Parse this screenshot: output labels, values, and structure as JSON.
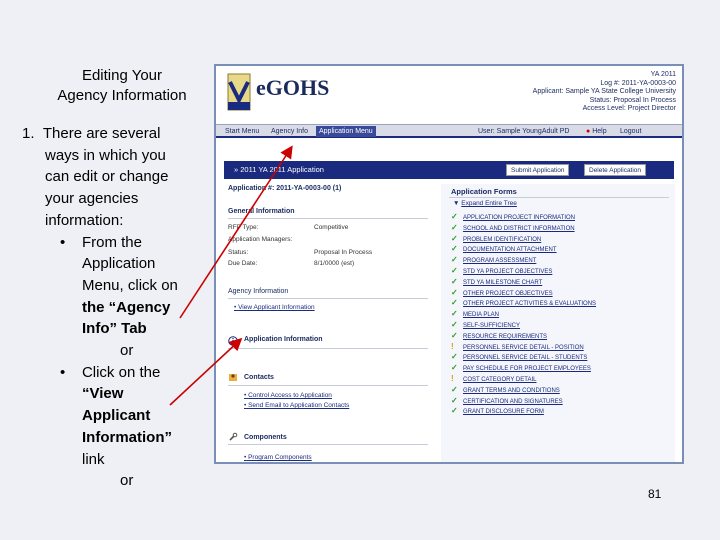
{
  "slide": {
    "title_line1": "Editing Your",
    "title_line2": "Agency Information",
    "step_number": "1.",
    "intro_lines": [
      "There are several",
      "ways in which you",
      "can edit or change",
      "your agencies",
      "information:"
    ],
    "bullet1_lines": [
      "From the",
      "Application",
      "Menu, click on",
      "the “Agency",
      "Info” Tab"
    ],
    "or1": "or",
    "bullet2_lines": [
      "Click on the",
      "“View",
      "Applicant",
      "Information”",
      "link"
    ],
    "or2": "or",
    "page_number": "81",
    "bullet_char": "•"
  },
  "screenshot": {
    "logo": "eGOHS",
    "header_info": [
      "YA 2011",
      "Log #: 2011-YA-0003-00",
      "Applicant: Sample YA State College University",
      "Status: Proposal In Process",
      "Access Level: Project Director"
    ],
    "tabs": [
      "Start Menu",
      "Agency Info",
      "Application Menu"
    ],
    "active_tab": "Application Menu",
    "user_label": "User: Sample YoungAdult PD",
    "help": "Help",
    "logout": "Logout",
    "page_title": "2011 YA 2011 Application",
    "submit_button": "Submit Application",
    "delete_button": "Delete Application",
    "application_number": "Application #: 2011-YA-0003-00 (1)",
    "general_info": {
      "heading": "General Information",
      "fields": [
        {
          "label": "RFP Type:",
          "value": "Competitive"
        },
        {
          "label": "Application Managers:",
          "value": ""
        },
        {
          "label": "Status:",
          "value": "Proposal In Process"
        },
        {
          "label": "Due Date:",
          "value": "8/1/0000 (est)"
        }
      ]
    },
    "agency_info": {
      "heading": "Agency Information",
      "link": "View Applicant Information"
    },
    "application_info_heading": "Application Information",
    "contacts": {
      "heading": "Contacts",
      "links": [
        "Control Access to Application",
        "Send Email to Application Contacts"
      ]
    },
    "components": {
      "heading": "Components",
      "links": [
        "Program Components"
      ]
    },
    "forms_title": "Application Forms",
    "expand_label": "Expand Entire Tree",
    "forms": [
      {
        "name": "APPLICATION PROJECT INFORMATION",
        "status": "check"
      },
      {
        "name": "SCHOOL AND DISTRICT INFORMATION",
        "status": "check"
      },
      {
        "name": "PROBLEM IDENTIFICATION",
        "status": "check"
      },
      {
        "name": "DOCUMENTATION ATTACHMENT",
        "status": "check"
      },
      {
        "name": "PROGRAM ASSESSMENT",
        "status": "check"
      },
      {
        "name": "STD YA PROJECT OBJECTIVES",
        "status": "check"
      },
      {
        "name": "STD YA MILESTONE CHART",
        "status": "check"
      },
      {
        "name": "OTHER PROJECT OBJECTIVES",
        "status": "check"
      },
      {
        "name": "OTHER PROJECT ACTIVITIES & EVALUATIONS",
        "status": "check"
      },
      {
        "name": "MEDIA PLAN",
        "status": "check"
      },
      {
        "name": "SELF-SUFFICIENCY",
        "status": "check"
      },
      {
        "name": "RESOURCE REQUIREMENTS",
        "status": "check"
      },
      {
        "name": "PERSONNEL SERVICE DETAIL - POSITION",
        "status": "warn"
      },
      {
        "name": "PERSONNEL SERVICE DETAIL - STUDENTS",
        "status": "check"
      },
      {
        "name": "PAY SCHEDULE FOR PROJECT EMPLOYEES",
        "status": "check"
      },
      {
        "name": "COST CATEGORY DETAIL",
        "status": "warn"
      },
      {
        "name": "GRANT TERMS AND CONDITIONS",
        "status": "check"
      },
      {
        "name": "CERTIFICATION AND SIGNATURES",
        "status": "check"
      },
      {
        "name": "GRANT DISCLOSURE FORM",
        "status": "check"
      }
    ],
    "colors": {
      "navy": "#1a2a7e",
      "check": "#2a9a2a",
      "warn": "#d4a000",
      "annotation_arrow": "#cc0000"
    }
  }
}
